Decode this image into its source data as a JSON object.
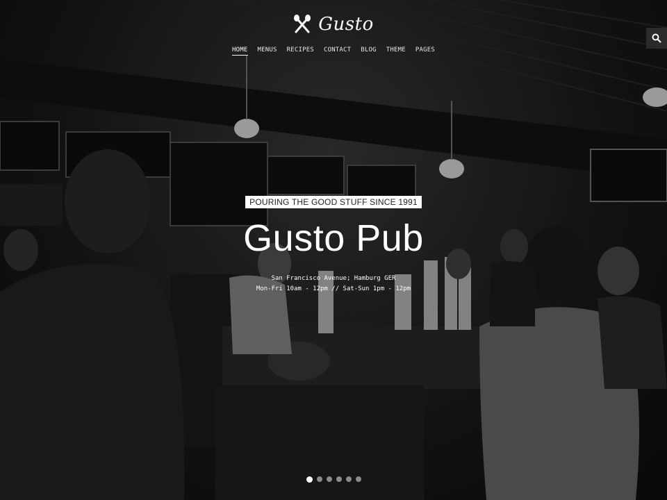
{
  "brand": {
    "name": "Gusto",
    "logo_icon": "fork-knife-icon"
  },
  "nav": {
    "items": [
      {
        "label": "HOME",
        "active": true
      },
      {
        "label": "MENUS"
      },
      {
        "label": "RECIPES"
      },
      {
        "label": "CONTACT"
      },
      {
        "label": "BLOG"
      },
      {
        "label": "THEME"
      },
      {
        "label": "PAGES"
      }
    ]
  },
  "search": {
    "icon": "search-icon"
  },
  "hero": {
    "tagline": "POURING THE GOOD STUFF SINCE 1991",
    "title": "Gusto Pub",
    "address": "San Francisco Avenue; Hamburg GER",
    "hours": "Mon-Fri 10am - 12pm // Sat-Sun 1pm - 12pm"
  },
  "slider": {
    "count": 6,
    "active_index": 0
  }
}
